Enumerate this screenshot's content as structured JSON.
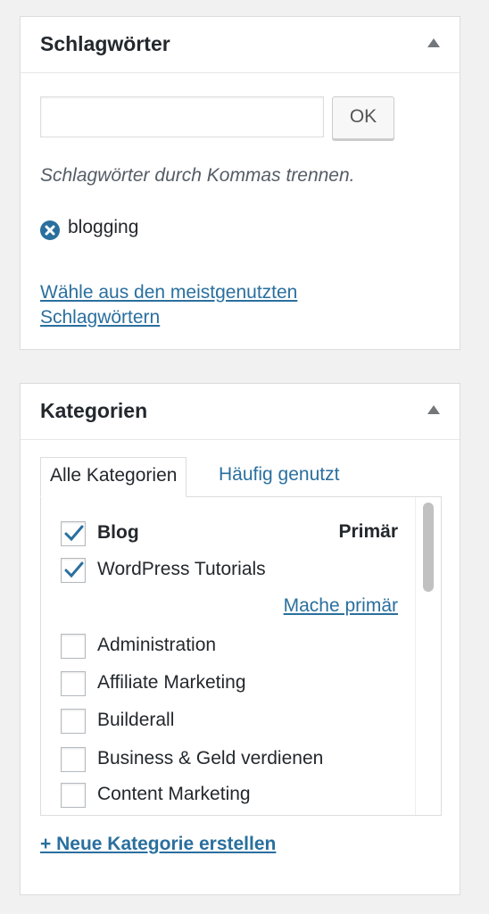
{
  "tags_box": {
    "title": "Schlagwörter",
    "input_value": "",
    "ok_label": "OK",
    "hint": "Schlagwörter durch Kommas trennen.",
    "tags": [
      {
        "label": "blogging",
        "icon": "remove-circle-icon"
      }
    ],
    "most_used_link": "Wähle aus den meistgenutzten Schlagwörtern"
  },
  "categories_box": {
    "title": "Kategorien",
    "tabs": [
      {
        "label": "Alle Kategorien",
        "active": true
      },
      {
        "label": "Häufig genutzt",
        "active": false
      }
    ],
    "primary_label": "Primär",
    "make_primary_link": "Mache primär",
    "categories": [
      {
        "label": "Blog",
        "checked": true,
        "primary": true
      },
      {
        "label": "WordPress Tutorials",
        "checked": true,
        "primary": false
      },
      {
        "label": "Administration",
        "checked": false
      },
      {
        "label": "Affiliate Marketing",
        "checked": false
      },
      {
        "label": "Builderall",
        "checked": false
      },
      {
        "label": "Business & Geld verdienen",
        "checked": false
      },
      {
        "label": "Content Marketing",
        "checked": false
      }
    ],
    "add_category_link": "+ Neue Kategorie erstellen"
  },
  "colors": {
    "link": "#2a6f9e",
    "checkmark": "#2a6f9e",
    "background": "#f1f1f1"
  }
}
